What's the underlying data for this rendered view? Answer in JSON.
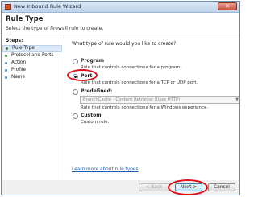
{
  "window": {
    "title": "New Inbound Rule Wizard",
    "close_glyph": "✕"
  },
  "header": {
    "title": "Rule Type",
    "subtitle": "Select the type of firewall rule to create."
  },
  "sidebar": {
    "steps_label": "Steps:",
    "items": [
      {
        "label": "Rule Type",
        "state": "active"
      },
      {
        "label": "Protocol and Ports",
        "state": "done"
      },
      {
        "label": "Action",
        "state": "pending"
      },
      {
        "label": "Profile",
        "state": "pending"
      },
      {
        "label": "Name",
        "state": "pending"
      }
    ]
  },
  "main": {
    "question": "What type of rule would you like to create?",
    "options": [
      {
        "title": "Program",
        "desc": "Rule that controls connections for a program.",
        "checked": false
      },
      {
        "title": "Port",
        "desc": "Rule that controls connections for a TCP or UDP port.",
        "checked": true
      },
      {
        "title": "Predefined:",
        "desc": "Rule that controls connections for a Windows experience.",
        "checked": false
      },
      {
        "title": "Custom",
        "desc": "Custom rule.",
        "checked": false
      }
    ],
    "predefined_select_value": "BranchCache - Content Retrieval (Uses HTTP)",
    "help_link": "Learn more about rule types"
  },
  "footer": {
    "back_label": "< Back",
    "next_label": "Next >",
    "cancel_label": "Cancel"
  },
  "colors": {
    "highlight": "#e0101a",
    "link": "#1a5fb4"
  }
}
